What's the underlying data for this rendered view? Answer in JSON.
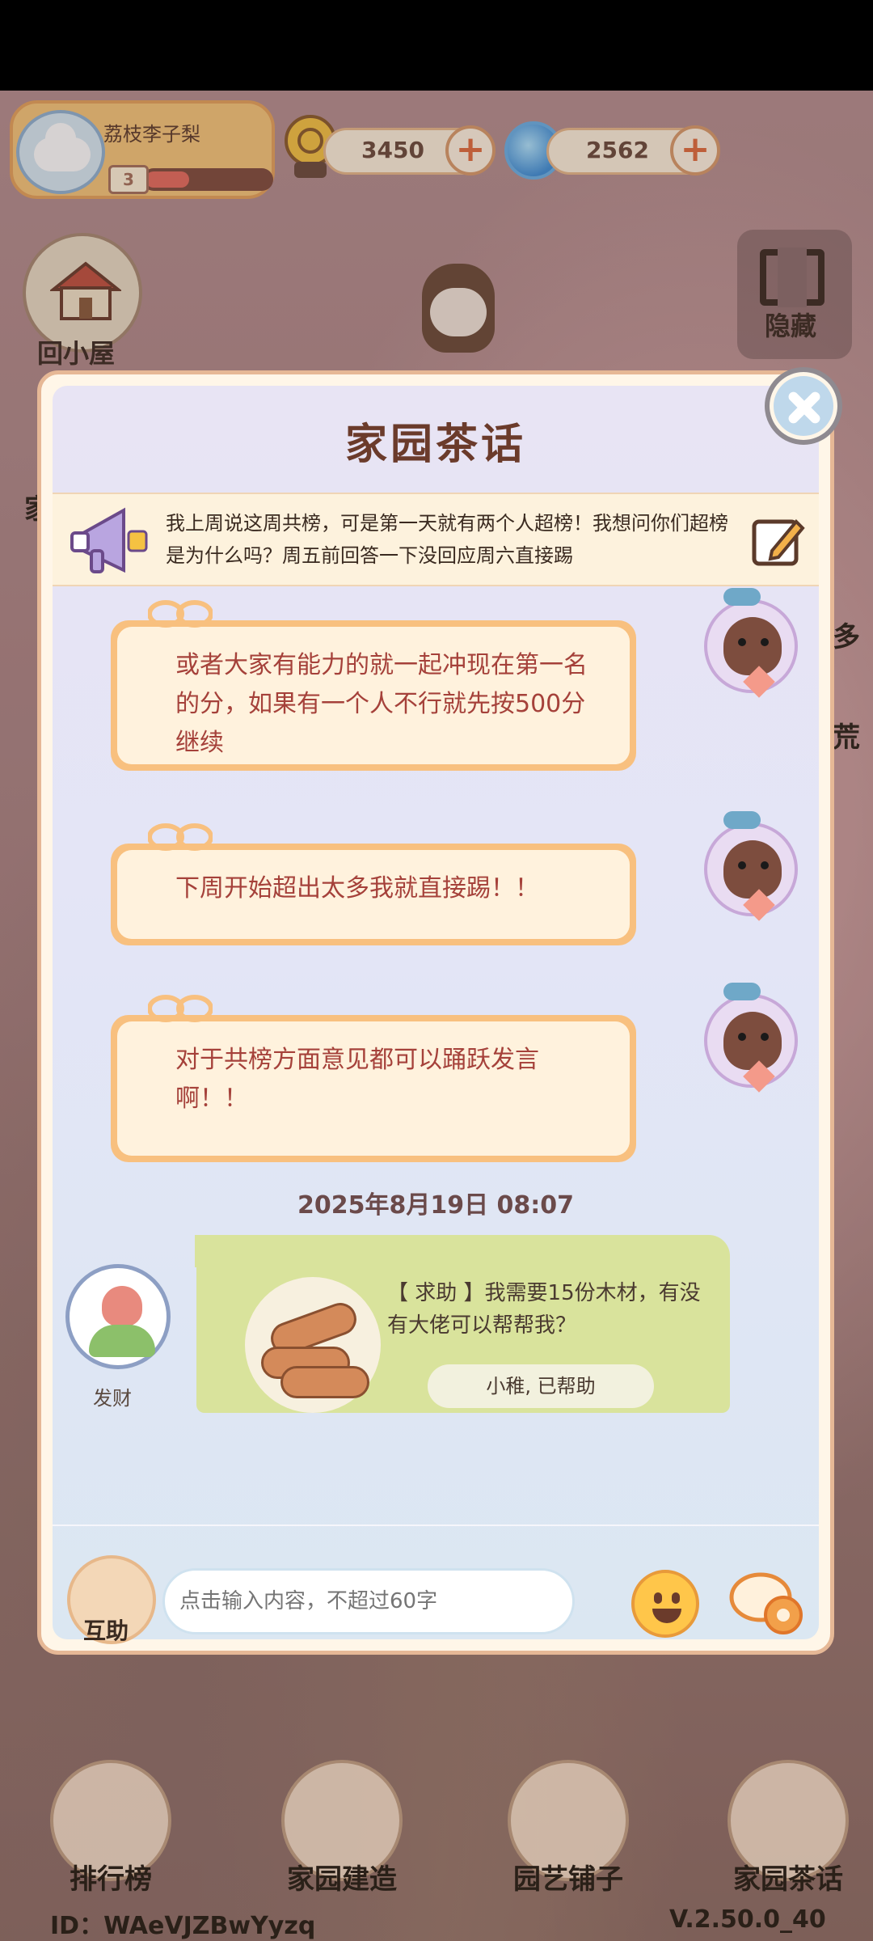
{
  "player": {
    "name": "荔枝李子梨",
    "level": "3",
    "xp_fraction": 0.35
  },
  "currencies": [
    {
      "name": "coin",
      "value": "3450",
      "icon": "gold-coin-icon"
    },
    {
      "name": "gem",
      "value": "2562",
      "icon": "blue-swirl-gem-icon"
    }
  ],
  "top_buttons": {
    "home_label": "回小屋",
    "hide_label": "隐藏"
  },
  "dialog": {
    "title": "家园茶话",
    "notice": "我上周说这周共榜，可是第一天就有两个人超榜！我想问你们超榜是为什么吗？周五前回答一下没回应周六直接踢",
    "messages": [
      {
        "text": "或者大家有能力的就一起冲现在第一名的分，如果有一个人不行就先按500分继续"
      },
      {
        "text": "下周开始超出太多我就直接踢！！"
      },
      {
        "text": "对于共榜方面意见都可以踊跃发言啊！！"
      }
    ],
    "timestamp": "2025年8月19日 08:07",
    "help_request": {
      "sender": "发财",
      "text": "【 求助 】我需要15份木材，有没有大佬可以帮帮我？",
      "status": "小稚, 已帮助"
    },
    "input": {
      "assist_label": "互助",
      "placeholder": "点击输入内容，不超过60字"
    }
  },
  "bottom_nav": [
    {
      "label": "排行榜"
    },
    {
      "label": "家园建造"
    },
    {
      "label": "园艺铺子"
    },
    {
      "label": "家园茶话"
    }
  ],
  "side_fragments": [
    "家",
    "多",
    "荒"
  ],
  "footer": {
    "id": "ID：WAeVJZBwYyzq",
    "version": "V.2.50.0_40"
  },
  "colors": {
    "bubble_border": "#f8c07f",
    "bubble_text": "#a5413a",
    "help_card": "#d9e39c",
    "title": "#6b3b2b"
  }
}
